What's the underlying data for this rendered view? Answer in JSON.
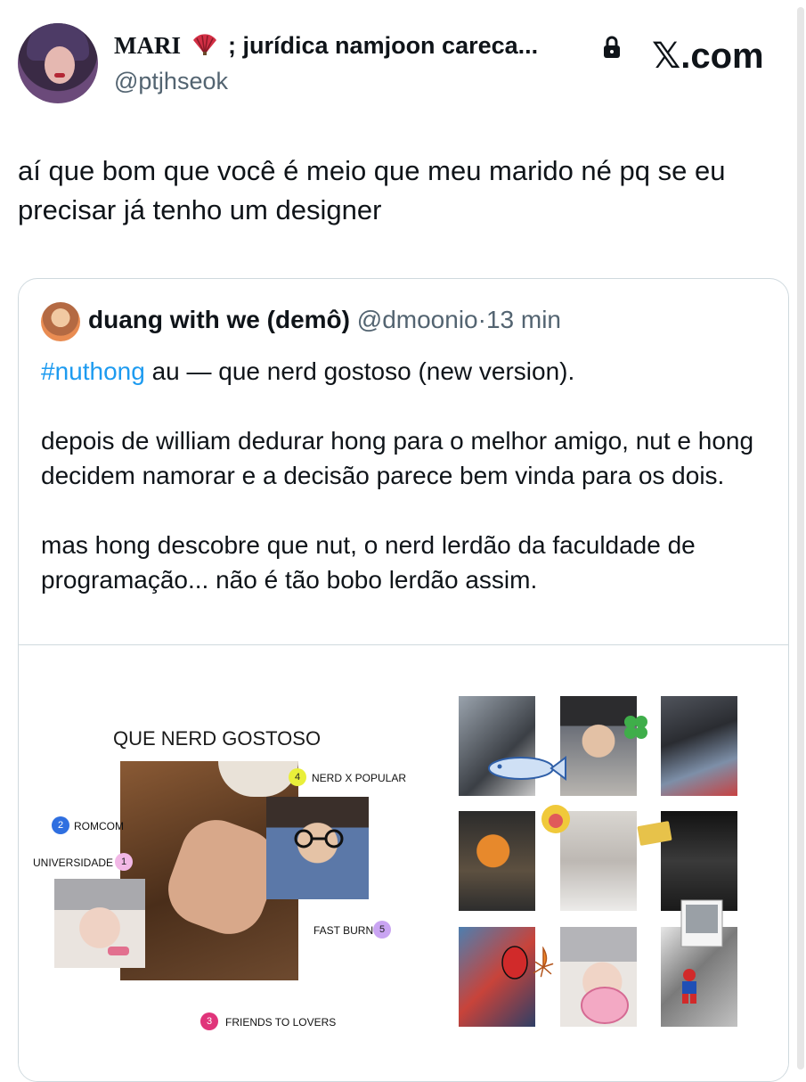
{
  "header": {
    "display_name_prefix": "MARI",
    "display_name_suffix": "; jurídica namjoon careca...",
    "handle": "@ptjhseok",
    "site_label": ".com",
    "site_x": "𝕏"
  },
  "tweet": {
    "text": "aí que bom que você é meio que meu marido né pq se eu precisar já tenho um designer"
  },
  "quote": {
    "name": "duang with we (demô)",
    "handle": "@dmoonio",
    "separator": "·",
    "time": "13 min",
    "hashtag": "#nuthong",
    "line1_rest": " au — que nerd gostoso (new version).",
    "para2": "depois de william dedurar hong para o melhor amigo, nut e hong decidem namorar e a decisão parece bem vinda para os dois.",
    "para3": "mas hong descobre que nut, o nerd lerdão da faculdade de programação... não é tão bobo lerdão assim."
  },
  "moodboard": {
    "title": "QUE NERD GOSTOSO",
    "tags": [
      {
        "num": "1",
        "label": "UNIVERSIDADE",
        "color": "#f2b8e6"
      },
      {
        "num": "2",
        "label": "ROMCOM",
        "color": "#2f6fe0"
      },
      {
        "num": "3",
        "label": "FRIENDS TO LOVERS",
        "color": "#e0347a"
      },
      {
        "num": "4",
        "label": "NERD X POPULAR",
        "color": "#e9ef3a"
      },
      {
        "num": "5",
        "label": "FAST BURN",
        "color": "#c9a4f2"
      }
    ]
  },
  "colors": {
    "link": "#1d9bf0",
    "secondary_text": "#536471",
    "border": "#cfd9de"
  }
}
